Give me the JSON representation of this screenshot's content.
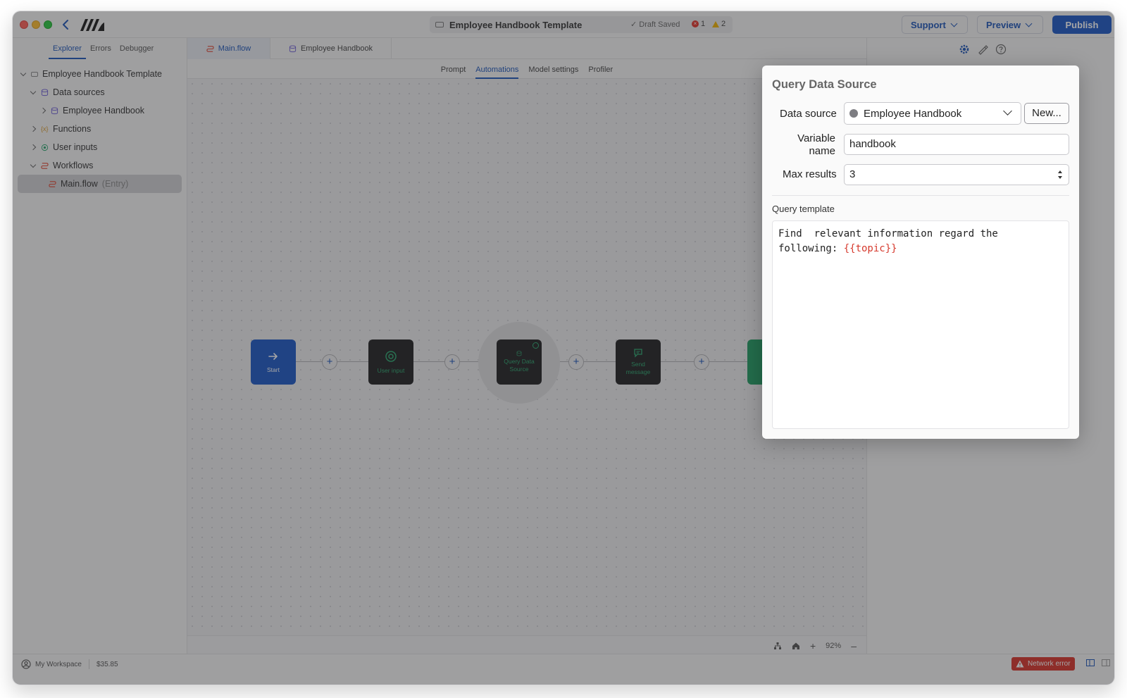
{
  "titlebar": {
    "doc_title": "Employee Handbook Template",
    "draft_status": "✓ Draft Saved",
    "error_count": "1",
    "warning_count": "2",
    "support_label": "Support",
    "preview_label": "Preview",
    "publish_label": "Publish"
  },
  "sidebar": {
    "tabs": [
      "Explorer",
      "Errors",
      "Debugger"
    ],
    "tree": {
      "root": "Employee Handbook Template",
      "data_sources": "Data sources",
      "employee_handbook": "Employee Handbook",
      "functions": "Functions",
      "user_inputs": "User inputs",
      "workflows": "Workflows",
      "main_flow": "Main.flow",
      "main_flow_tag": "(Entry)"
    }
  },
  "editor": {
    "tabs": [
      "Main.flow",
      "Employee Handbook"
    ],
    "subtabs": [
      "Prompt",
      "Automations",
      "Model settings",
      "Profiler"
    ],
    "nodes": {
      "start": "Start",
      "user_input": "User input",
      "query": "Query Data Source",
      "send": "Send message"
    },
    "zoom": "92%"
  },
  "status": {
    "workspace": "My Workspace",
    "balance": "$35.85",
    "network_error": "Network error"
  },
  "modal": {
    "title": "Query Data Source",
    "data_source_label": "Data source",
    "data_source_value": "Employee Handbook",
    "new_button": "New...",
    "variable_label_1": "Variable",
    "variable_label_2": "name",
    "variable_value": "handbook",
    "max_results_label": "Max results",
    "max_results_value": "3",
    "query_template_label": "Query template",
    "query_text_prefix": "Find  relevant information regard the\nfollowing: ",
    "query_text_var": "{{topic}}"
  },
  "colors": {
    "accent": "#1a56c5",
    "node_dark": "#1f1f21",
    "node_green": "#2aa66e",
    "error": "#d8322a"
  }
}
